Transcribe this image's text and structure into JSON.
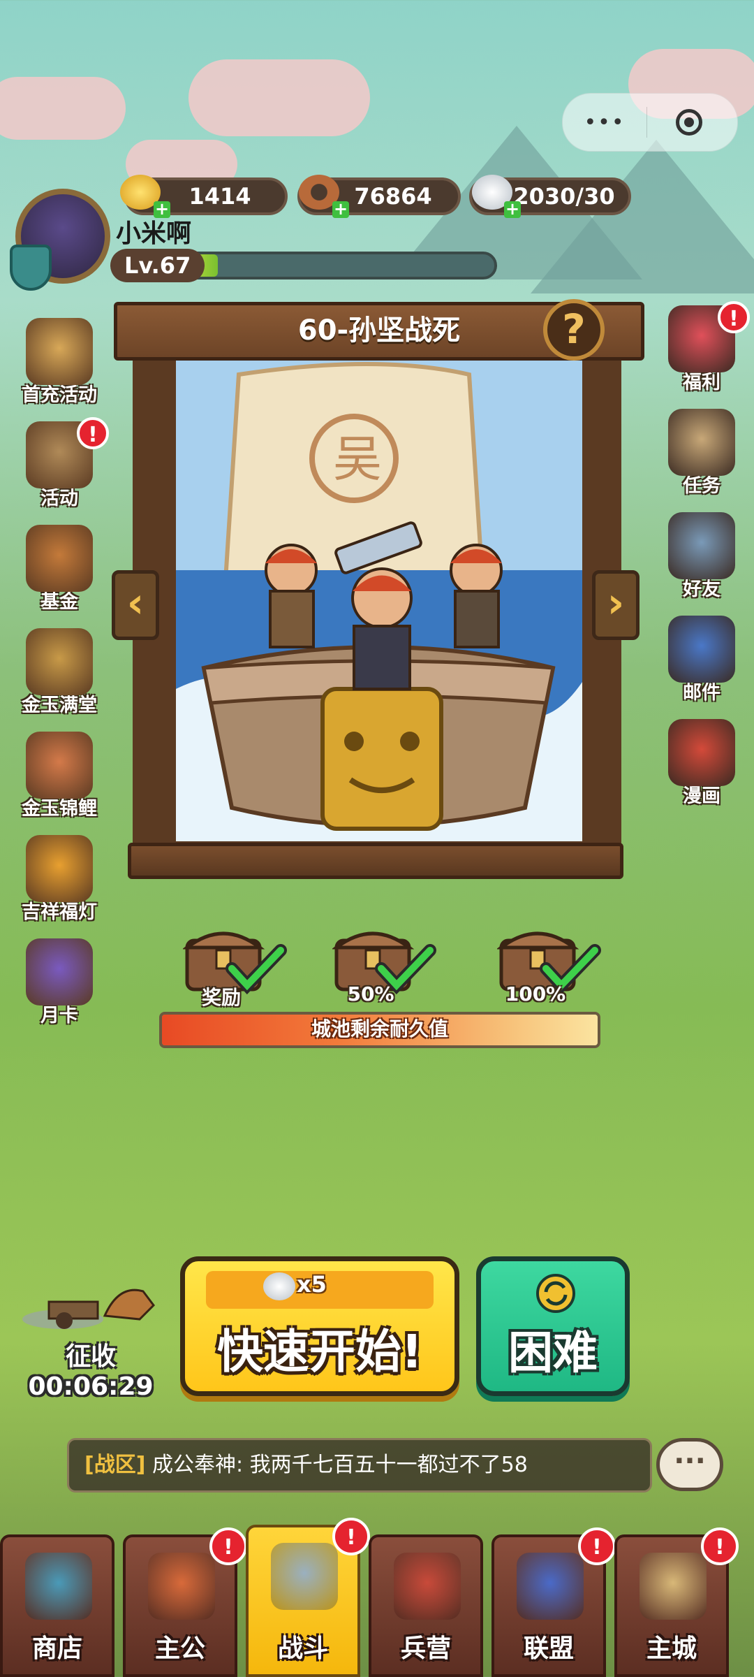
{
  "capsule": {
    "menu_icon": "more-dots-icon",
    "close_icon": "target-circle-icon"
  },
  "resources": [
    {
      "icon": "gold-ingot-icon",
      "value": "1414"
    },
    {
      "icon": "copper-coin-icon",
      "value": "76864"
    },
    {
      "icon": "rice-bowl-icon",
      "value": "2030/30"
    }
  ],
  "player": {
    "name": "小米啊",
    "level": "Lv.67",
    "exp_fraction": 0.1
  },
  "left_menu": [
    {
      "label": "首充活动",
      "icon": "gold-sacks-icon",
      "badge": false
    },
    {
      "label": "活动",
      "icon": "scroll-activity-icon",
      "badge": true
    },
    {
      "label": "基金",
      "icon": "treasure-box-icon",
      "badge": false
    },
    {
      "label": "金玉满堂",
      "icon": "golden-toad-icon",
      "badge": false
    },
    {
      "label": "金玉锦鲤",
      "icon": "koi-fish-icon",
      "badge": false
    },
    {
      "label": "吉祥福灯",
      "icon": "lantern-icon",
      "badge": false
    },
    {
      "label": "月卡",
      "icon": "month-card-icon",
      "badge": false
    }
  ],
  "right_menu": [
    {
      "label": "福利",
      "icon": "gift-box-icon",
      "badge": true
    },
    {
      "label": "任务",
      "icon": "quest-scroll-icon",
      "badge": false
    },
    {
      "label": "好友",
      "icon": "handshake-icon",
      "badge": false
    },
    {
      "label": "邮件",
      "icon": "mail-icon",
      "badge": false
    },
    {
      "label": "漫画",
      "icon": "comic-book-icon",
      "badge": false
    }
  ],
  "stage": {
    "title": "60-孙坚战死",
    "help": "?",
    "prev": "‹",
    "next": "›"
  },
  "rewards": [
    {
      "label": "奖励",
      "claimed": true
    },
    {
      "label": "50%",
      "claimed": true
    },
    {
      "label": "100%",
      "claimed": true
    }
  ],
  "durability": {
    "label": "城池剩余耐久值",
    "fraction": 1.0
  },
  "collect": {
    "label": "征收",
    "timer": "00:06:29"
  },
  "quick_start": {
    "cost": "x5",
    "label": "快速开始!"
  },
  "hard": {
    "label": "困难"
  },
  "chat": {
    "zone": "[战区]",
    "message": "成公奉神: 我两千七百五十一都过不了58",
    "bubble": "···"
  },
  "nav": [
    {
      "label": "商店",
      "icon": "shop-icon",
      "badge": false,
      "active": false
    },
    {
      "label": "主公",
      "icon": "lord-icon",
      "badge": true,
      "active": false
    },
    {
      "label": "战斗",
      "icon": "crossed-swords-icon",
      "badge": true,
      "active": true
    },
    {
      "label": "兵营",
      "icon": "barracks-icon",
      "badge": false,
      "active": false
    },
    {
      "label": "联盟",
      "icon": "alliance-flag-icon",
      "badge": true,
      "active": false
    },
    {
      "label": "主城",
      "icon": "city-map-icon",
      "badge": true,
      "active": false
    }
  ],
  "colors": {
    "accent_yellow": "#ffc61a",
    "accent_green": "#1fb884",
    "badge_red": "#e5232f",
    "wood": "#5b3a22"
  }
}
